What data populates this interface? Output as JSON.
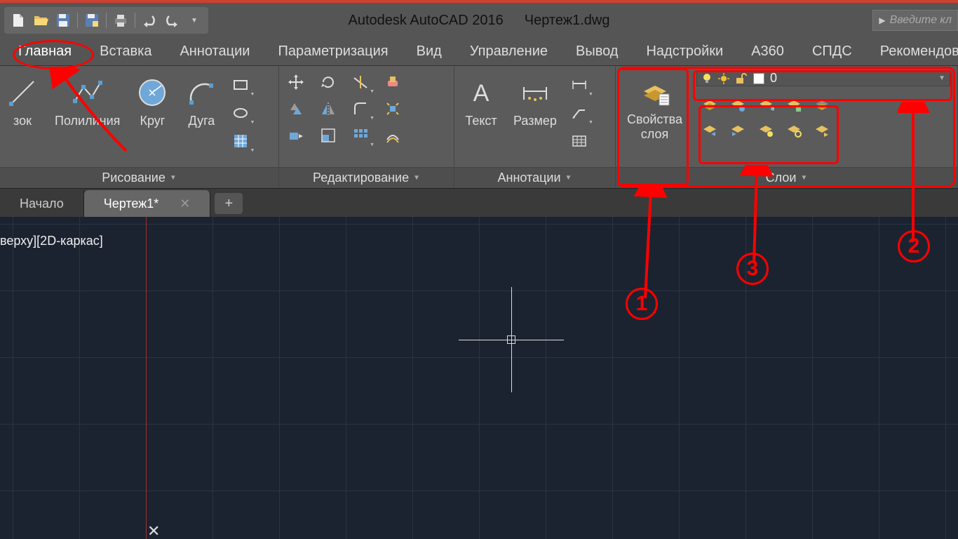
{
  "titlebar": {
    "app_title": "Autodesk AutoCAD 2016",
    "file_name": "Чертеж1.dwg",
    "keyword_placeholder": "Введите кл"
  },
  "tabs": {
    "items": [
      {
        "label": "Главная",
        "active": true
      },
      {
        "label": "Вставка"
      },
      {
        "label": "Аннотации"
      },
      {
        "label": "Параметризация"
      },
      {
        "label": "Вид"
      },
      {
        "label": "Управление"
      },
      {
        "label": "Вывод"
      },
      {
        "label": "Надстройки"
      },
      {
        "label": "A360"
      },
      {
        "label": "СПДС"
      },
      {
        "label": "Рекомендова"
      }
    ]
  },
  "ribbon": {
    "draw": {
      "title": "Рисование",
      "segment_label": "зок",
      "polyline_label": "Полилиния",
      "circle_label": "Круг",
      "arc_label": "Дуга"
    },
    "modify": {
      "title": "Редактирование"
    },
    "annotate": {
      "title": "Аннотации",
      "text_label": "Текст",
      "dim_label": "Размер"
    },
    "layers": {
      "title": "Слои",
      "properties_label_1": "Свойства",
      "properties_label_2": "слоя",
      "current_layer": "0"
    }
  },
  "doctabs": {
    "start": "Начало",
    "active": "Чертеж1*"
  },
  "canvas": {
    "view_label": "верху][2D-каркас]"
  },
  "annotations": {
    "n1": "1",
    "n2": "2",
    "n3": "3"
  }
}
